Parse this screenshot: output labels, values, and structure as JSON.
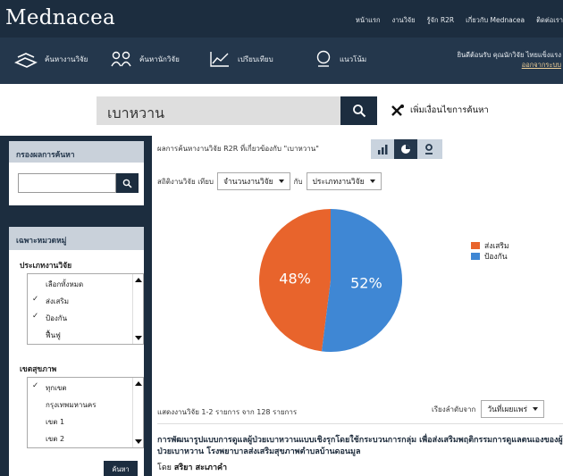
{
  "app": {
    "logo": "Mednacea"
  },
  "top_links": [
    "หน้าแรก",
    "งานวิจัย",
    "รู้จัก R2R",
    "เกี่ยวกับ Mednacea",
    "ติดต่อเรา"
  ],
  "nav": {
    "items": [
      {
        "label": "ค้นหางานวิจัย",
        "icon": "search-research-icon"
      },
      {
        "label": "ค้นหานักวิจัย",
        "icon": "researchers-icon"
      },
      {
        "label": "เปรียบเทียบ",
        "icon": "compare-chart-icon"
      },
      {
        "label": "แนวโน้ม",
        "icon": "trend-globe-icon"
      }
    ],
    "welcome": "ยินดีต้อนรับ คุณนักวิจัย ไทยแข็งแรง",
    "logout": "ออกจากระบบ"
  },
  "search": {
    "query": "เบาหวาน",
    "advanced_label": "เพิ่มเงื่อนไขการค้นหา"
  },
  "sidebar": {
    "filter_title": "กรองผลการค้นหา",
    "filter_value": "",
    "category_title": "เฉพาะหมวดหมู่",
    "research_type_label": "ประเภทงานวิจัย",
    "research_types": [
      {
        "label": "เลือกทั้งหมด",
        "checked": false
      },
      {
        "label": "ส่งเสริม",
        "checked": true
      },
      {
        "label": "ป้องกัน",
        "checked": true
      },
      {
        "label": "ฟื้นฟู",
        "checked": false
      }
    ],
    "health_zone_label": "เขตสุขภาพ",
    "health_zones": [
      {
        "label": "ทุกเขต",
        "checked": true
      },
      {
        "label": "กรุงเทพมหานคร",
        "checked": false
      },
      {
        "label": "เขต 1",
        "checked": false
      },
      {
        "label": "เขต 2",
        "checked": false
      }
    ],
    "search_button": "ค้นหา"
  },
  "main": {
    "result_summary": "ผลการค้นหางานวิจัย R2R ที่เกี่ยวข้องกับ \"เบาหวาน\"",
    "stat_prefix": "สถิติงานวิจัย เทียบ",
    "stat_measure": "จำนวนงานวิจัย",
    "stat_with": "กับ",
    "stat_dimension": "ประเภทงานวิจัย",
    "shown_text": "แสดงงานวิจัย 1-2 รายการ จาก 128 รายการ",
    "sort_label": "เรียงลำดับจาก",
    "sort_value": "วันที่เผยแพร่",
    "result": {
      "title": "การพัฒนารูปแบบการดูแลผู้ป่วยเบาหวานแบบเชิงรุกโดยใช้กระบวนการกลุ่ม เพื่อส่งเสริมพฤติกรรมการดูแลตนเองของผู้ป่วยเบาหวาน โรงพยาบาลส่งเสริมสุขภาพตำบลบ้านดอนมูล",
      "author_prefix": "โดย",
      "author": "สริยา สะเภาคำ"
    }
  },
  "colors": {
    "header_dark": "#1c2d3f",
    "nav": "#24374c",
    "slice_promote": "#e8642c",
    "slice_prevent": "#3f87d4"
  },
  "chart_data": {
    "type": "pie",
    "categories": [
      "ส่งเสริม",
      "ป้องกัน"
    ],
    "values": [
      48,
      52
    ],
    "labels": [
      "48%",
      "52%"
    ],
    "colors": [
      "#e8642c",
      "#3f87d4"
    ],
    "legend": "right"
  }
}
